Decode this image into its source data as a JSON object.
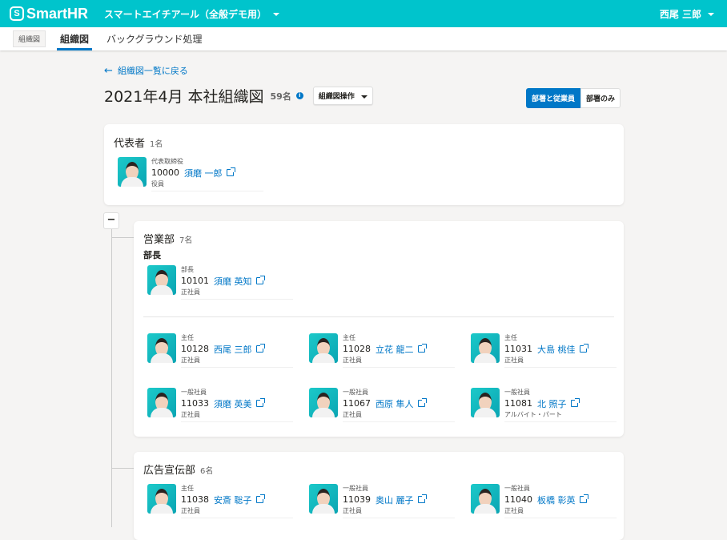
{
  "header": {
    "logo": "SmartHR",
    "company": "スマートエイチアール（全般デモ用）",
    "user": "西尾 三郎"
  },
  "tabs": {
    "app_label": "組織図",
    "items": [
      "組織図",
      "バックグラウンド処理"
    ]
  },
  "page": {
    "back": "組織図一覧に戻る",
    "title": "2021年4月 本社組織図",
    "count": "59名",
    "ops": "組織図操作",
    "toggle": [
      "部署と従業員",
      "部署のみ"
    ]
  },
  "rep": {
    "name": "代表者",
    "count": "1名",
    "emp": {
      "pos": "代表取締役",
      "id": "10000",
      "name": "須磨 一郎",
      "type": "役員"
    }
  },
  "sales": {
    "name": "営業部",
    "count": "7名",
    "head_label": "部長",
    "head": {
      "pos": "部長",
      "id": "10101",
      "name": "須磨 英知",
      "type": "正社員"
    },
    "members": [
      {
        "pos": "主任",
        "id": "10128",
        "name": "西尾 三郎",
        "type": "正社員"
      },
      {
        "pos": "主任",
        "id": "11028",
        "name": "立花 龍二",
        "type": "正社員"
      },
      {
        "pos": "主任",
        "id": "11031",
        "name": "大島 桃佳",
        "type": "正社員"
      },
      {
        "pos": "一般社員",
        "id": "11033",
        "name": "須磨 英美",
        "type": "正社員"
      },
      {
        "pos": "一般社員",
        "id": "11067",
        "name": "西原 隼人",
        "type": "正社員"
      },
      {
        "pos": "一般社員",
        "id": "11081",
        "name": "北 照子",
        "type": "アルバイト・パート"
      }
    ]
  },
  "ad": {
    "name": "広告宣伝部",
    "count": "6名",
    "members": [
      {
        "pos": "主任",
        "id": "11038",
        "name": "安斎 聡子",
        "type": "正社員"
      },
      {
        "pos": "一般社員",
        "id": "11039",
        "name": "奥山 麗子",
        "type": "正社員"
      },
      {
        "pos": "一般社員",
        "id": "11040",
        "name": "板橋 彰英",
        "type": "正社員"
      }
    ]
  }
}
